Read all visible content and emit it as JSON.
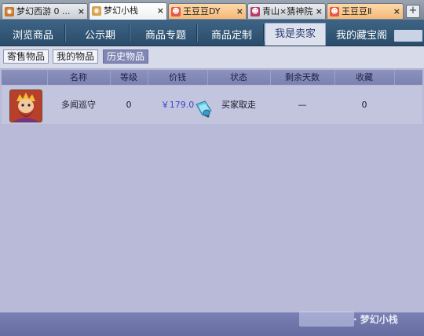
{
  "browser_tabs": [
    {
      "label": "梦幻西游 0 ...",
      "icon": "game-icon",
      "active": false
    },
    {
      "label": "梦幻小栈",
      "icon": "game-icon",
      "active": true
    },
    {
      "label": "王豆豆DY",
      "icon": "avatar-icon",
      "active": false
    },
    {
      "label": "青山×猜神院",
      "icon": "avatar-icon",
      "active": false
    },
    {
      "label": "王豆豆Ⅱ",
      "icon": "avatar-icon",
      "active": false
    }
  ],
  "tab_close_glyph": "×",
  "new_tab_glyph": "+",
  "main_nav": [
    "浏览商品",
    "公示期",
    "商品专题",
    "商品定制",
    "我是卖家",
    "我的藏宝阁"
  ],
  "sub_nav": [
    "寄售物品",
    "我的物品",
    "历史物品"
  ],
  "table": {
    "headers": [
      "名称",
      "等级",
      "价钱",
      "状态",
      "剩余天数",
      "收藏"
    ],
    "rows": [
      {
        "name": "多闻巡守",
        "level": "0",
        "price": "￥179.0",
        "status": "买家取走",
        "days_left": "—",
        "favorites": "0"
      }
    ]
  },
  "watermark": "· 梦幻小栈",
  "colors": {
    "nav_bg": "#2f5577",
    "nav_active_bg": "#dde1ee",
    "content_bg": "#b9bad8",
    "header_bg": "#8187b6",
    "price_color": "#3546d0",
    "footer_bg": "#6e74a8"
  }
}
